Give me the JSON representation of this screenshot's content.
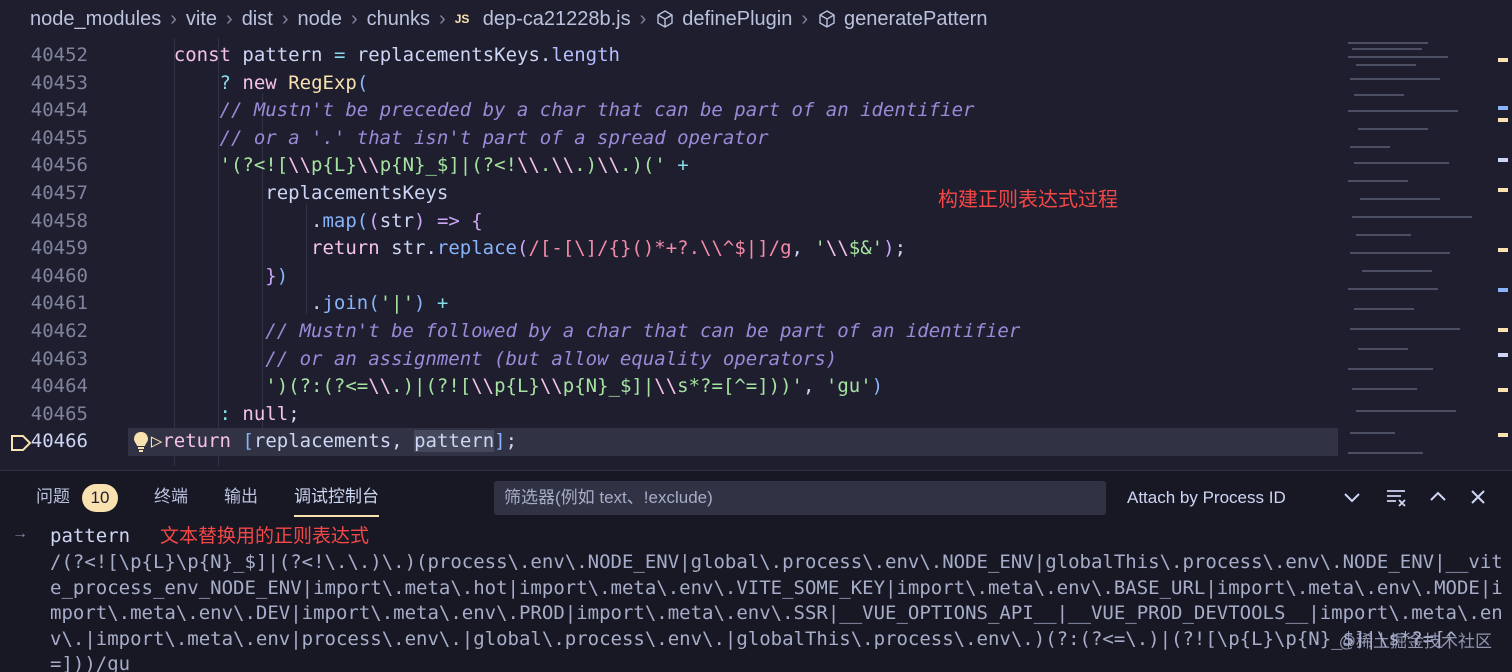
{
  "breadcrumb": {
    "items": [
      "node_modules",
      "vite",
      "dist",
      "node",
      "chunks"
    ],
    "file": "dep-ca21228b.js",
    "file_icon": "JS",
    "symbols": [
      "definePlugin",
      "generatePattern"
    ]
  },
  "editor": {
    "line_numbers": [
      "40452",
      "40453",
      "40454",
      "40455",
      "40456",
      "40457",
      "40458",
      "40459",
      "40460",
      "40461",
      "40462",
      "40463",
      "40464",
      "40465",
      "40466"
    ],
    "active_line": "40466",
    "annotation": "构建正则表达式过程"
  },
  "panel": {
    "tabs": {
      "problems": "问题",
      "problems_count": "10",
      "terminal": "终端",
      "output": "输出",
      "debug_console": "调试控制台"
    },
    "filter_placeholder": "筛选器(例如 text、!exclude)",
    "process": "Attach by Process ID",
    "console": {
      "arrow": "→",
      "expression": "pattern",
      "note": "文本替换用的正则表达式",
      "result": "/(?<![\\p{L}\\p{N}_$]|(?<!\\.\\.)\\.)(process\\.env\\.NODE_ENV|global\\.process\\.env\\.NODE_ENV|globalThis\\.process\\.env\\.NODE_ENV|__vite_process_env_NODE_ENV|import\\.meta\\.hot|import\\.meta\\.env\\.VITE_SOME_KEY|import\\.meta\\.env\\.BASE_URL|import\\.meta\\.env\\.MODE|import\\.meta\\.env\\.DEV|import\\.meta\\.env\\.PROD|import\\.meta\\.env\\.SSR|__VUE_OPTIONS_API__|__VUE_PROD_DEVTOOLS__|import\\.meta\\.env\\.|import\\.meta\\.env|process\\.env\\.|global\\.process\\.env\\.|globalThis\\.process\\.env\\.)(?:(?<=\\.)|(?![\\p{L}\\p{N}_$]|\\s*?=[^=]))/gu"
    }
  },
  "watermark": "@稀土掘金技术社区",
  "colors": {
    "background": "#1e1e2e",
    "panel_background": "#181825",
    "annotation_red": "#f44747",
    "accent_yellow": "#f9e2af"
  }
}
